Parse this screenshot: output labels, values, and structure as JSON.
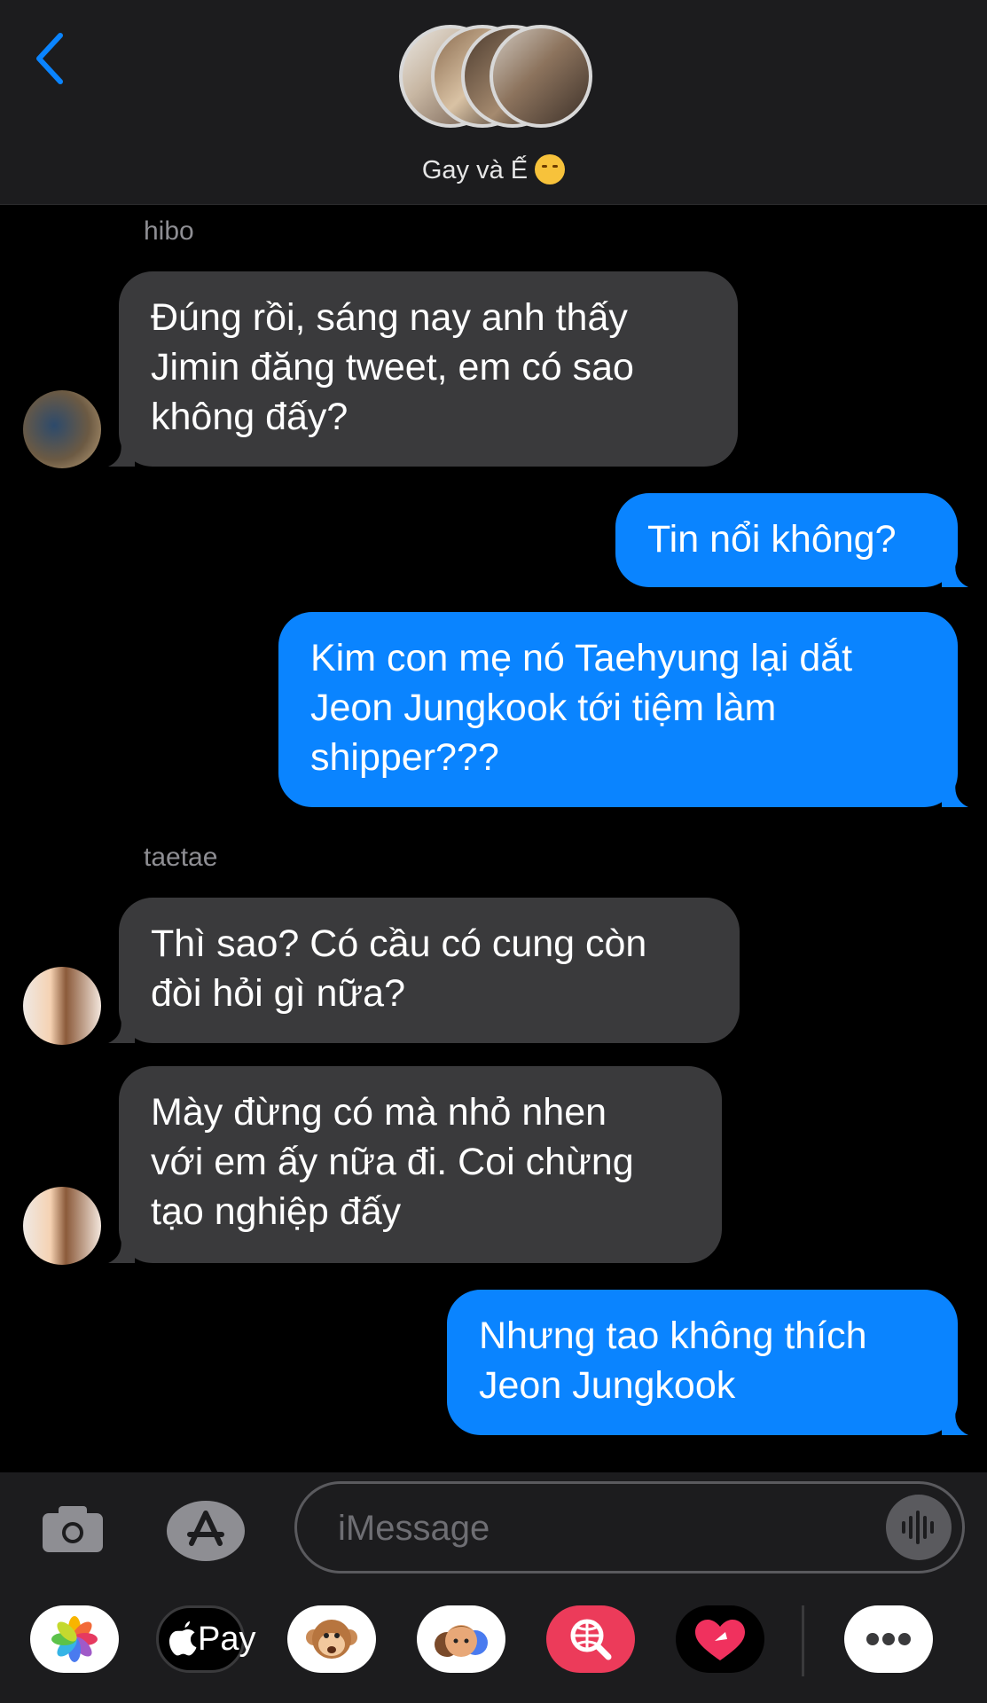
{
  "header": {
    "group_name": "Gay và Ế"
  },
  "messages": [
    {
      "sender": "hibo",
      "side": "left",
      "text_lines": [
        "Đúng rồi, sáng nay anh thấy",
        "Jimin đăng tweet, em có sao",
        "không đấy?"
      ]
    },
    {
      "side": "right",
      "text_lines": [
        "Tin nổi không?"
      ]
    },
    {
      "side": "right",
      "text_lines": [
        "Kim con mẹ nó Taehyung lại dắt",
        "Jeon Jungkook tới tiệm làm",
        "shipper???"
      ]
    },
    {
      "sender": "taetae",
      "side": "left",
      "text_lines": [
        "Thì sao? Có cầu có cung còn",
        "đòi hỏi gì nữa?"
      ]
    },
    {
      "side": "left",
      "text_lines": [
        "Mày đừng có mà nhỏ nhen",
        "với em ấy nữa đi. Coi chừng",
        "tạo nghiệp đấy"
      ]
    },
    {
      "side": "right",
      "text_lines": [
        "Nhưng tao không thích",
        "Jeon Jungkook"
      ]
    }
  ],
  "compose": {
    "placeholder": "iMessage",
    "apple_pay_label": "Pay"
  },
  "colors": {
    "accent": "#0a84ff",
    "incoming_bubble": "#3a3a3c",
    "background": "#000000"
  }
}
